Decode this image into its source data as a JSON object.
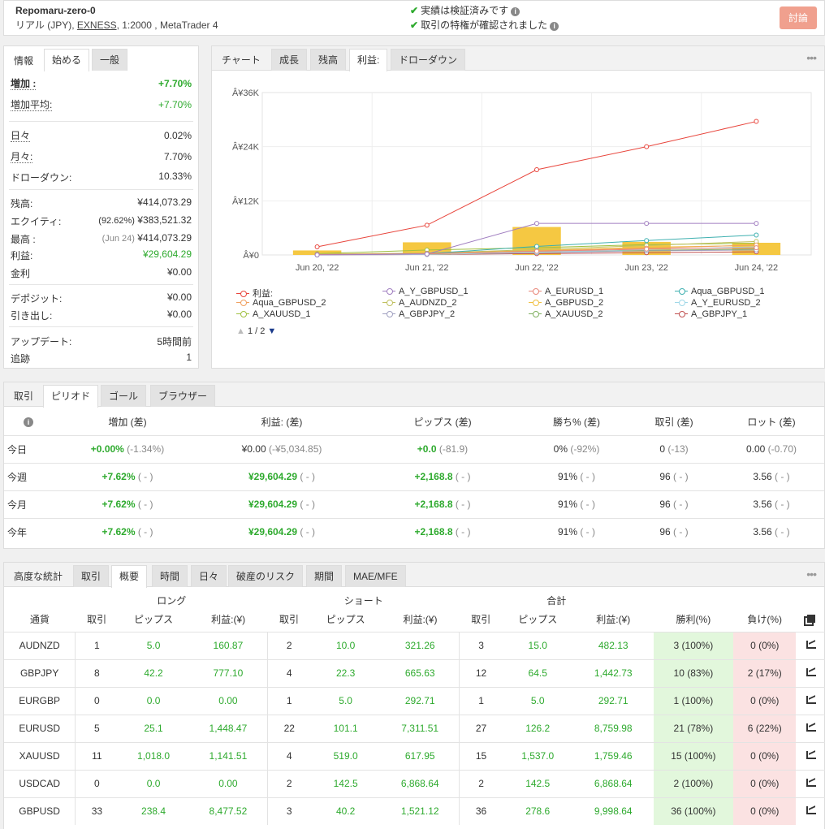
{
  "header": {
    "account_name": "Repomaru-zero-0",
    "account_sub_prefix": "リアル (JPY), ",
    "broker": "EXNESS",
    "account_sub_suffix": ", 1:2000 , MetaTrader 4",
    "verified_track": "実績は検証済みです",
    "verified_privilege": "取引の特権が確認されました",
    "discuss_label": "討論"
  },
  "info_panel": {
    "tabs": [
      "情報",
      "始める",
      "一般"
    ],
    "gain_label": "増加 :",
    "gain_value": "+7.70%",
    "avg_gain_label": "増加平均:",
    "avg_gain_value": "+7.70%",
    "daily_label": "日々",
    "daily_value": "0.02%",
    "monthly_label": "月々:",
    "monthly_value": "7.70%",
    "drawdown_label": "ドローダウン:",
    "drawdown_value": "10.33%",
    "balance_label": "残高:",
    "balance_value": "¥414,073.29",
    "equity_label": "エクイティ:",
    "equity_pct": "(92.62%)",
    "equity_value": "¥383,521.32",
    "highest_label": "最高 :",
    "highest_date": "(Jun 24)",
    "highest_value": "¥414,073.29",
    "profit_label": "利益:",
    "profit_value": "¥29,604.29",
    "interest_label": "金利",
    "interest_value": "¥0.00",
    "deposits_label": "デポジット:",
    "deposits_value": "¥0.00",
    "withdrawals_label": "引き出し:",
    "withdrawals_value": "¥0.00",
    "updated_label": "アップデート:",
    "updated_value": "5時間前",
    "tracking_label": "追跡",
    "tracking_value": "1"
  },
  "chart_panel": {
    "tabs": [
      "チャート",
      "成長",
      "残高",
      "利益:",
      "ドローダウン"
    ],
    "pager": "1 / 2",
    "legend": [
      {
        "label": "利益:",
        "color": "#e8453c"
      },
      {
        "label": "A_Y_GBPUSD_1",
        "color": "#a07ec0"
      },
      {
        "label": "A_EURUSD_1",
        "color": "#e8877a"
      },
      {
        "label": "Aqua_GBPUSD_1",
        "color": "#3fb0b0"
      },
      {
        "label": "Aqua_GBPUSD_2",
        "color": "#f0a060"
      },
      {
        "label": "A_AUDNZD_2",
        "color": "#c0c060"
      },
      {
        "label": "A_GBPUSD_2",
        "color": "#f0c040"
      },
      {
        "label": "A_Y_EURUSD_2",
        "color": "#a0d8e8"
      },
      {
        "label": "A_XAUUSD_1",
        "color": "#a0c040"
      },
      {
        "label": "A_GBPJPY_2",
        "color": "#a0a0c0"
      },
      {
        "label": "A_XAUUSD_2",
        "color": "#80b060"
      },
      {
        "label": "A_GBPJPY_1",
        "color": "#c05050"
      }
    ]
  },
  "chart_data": {
    "type": "line",
    "x": [
      "Jun 20, '22",
      "Jun 21, '22",
      "Jun 22, '22",
      "Jun 23, '22",
      "Jun 24, '22"
    ],
    "y_ticks": [
      "Â¥0",
      "Â¥12K",
      "Â¥24K",
      "Â¥36K"
    ],
    "ylim": [
      0,
      36000
    ],
    "bars": [
      1000,
      2800,
      6200,
      2900,
      2700
    ],
    "bar_color": "#f5c842",
    "series": [
      {
        "name": "利益:",
        "values": [
          1800,
          6600,
          18900,
          24000,
          29600
        ]
      },
      {
        "name": "A_Y_GBPUSD_1",
        "values": [
          0,
          200,
          7000,
          7000,
          7000
        ]
      },
      {
        "name": "A_EURUSD_1",
        "values": [
          100,
          300,
          800,
          1300,
          1600
        ]
      },
      {
        "name": "Aqua_GBPUSD_1",
        "values": [
          0,
          300,
          1900,
          3200,
          4400
        ]
      },
      {
        "name": "Aqua_GBPUSD_2",
        "values": [
          0,
          200,
          900,
          1500,
          2200
        ]
      },
      {
        "name": "A_AUDNZD_2",
        "values": [
          200,
          400,
          1200,
          2100,
          3000
        ]
      },
      {
        "name": "A_GBPUSD_2",
        "values": [
          100,
          300,
          1000,
          1700,
          2100
        ]
      },
      {
        "name": "A_Y_EURUSD_2",
        "values": [
          0,
          100,
          600,
          1200,
          1800
        ]
      },
      {
        "name": "A_XAUUSD_1",
        "values": [
          300,
          1100,
          1600,
          2300,
          2600
        ]
      },
      {
        "name": "A_GBPJPY_2",
        "values": [
          0,
          200,
          500,
          900,
          1100
        ]
      },
      {
        "name": "A_XAUUSD_2",
        "values": [
          100,
          300,
          600,
          1000,
          1300
        ]
      },
      {
        "name": "A_GBPJPY_1",
        "values": [
          0,
          100,
          300,
          500,
          700
        ]
      }
    ]
  },
  "period_panel": {
    "tabs": [
      "取引",
      "ピリオド",
      "ゴール",
      "ブラウザー"
    ],
    "headers": [
      "増加 (差)",
      "利益: (差)",
      "ピップス (差)",
      "勝ち% (差)",
      "取引 (差)",
      "ロット (差)"
    ],
    "rows": [
      {
        "label": "今日",
        "cells": [
          [
            "+0.00%",
            " (-1.34%)"
          ],
          [
            "¥0.00",
            " (-¥5,034.85)"
          ],
          [
            "+0.0",
            " (-81.9)"
          ],
          [
            "0%",
            " (-92%)"
          ],
          [
            "0",
            " (-13)"
          ],
          [
            "0.00",
            " (-0.70)"
          ]
        ]
      },
      {
        "label": "今週",
        "cells": [
          [
            "+7.62%",
            " ( - )"
          ],
          [
            "¥29,604.29",
            " ( - )"
          ],
          [
            "+2,168.8",
            " ( - )"
          ],
          [
            "91%",
            " ( - )"
          ],
          [
            "96",
            " ( - )"
          ],
          [
            "3.56",
            " ( - )"
          ]
        ]
      },
      {
        "label": "今月",
        "cells": [
          [
            "+7.62%",
            " ( - )"
          ],
          [
            "¥29,604.29",
            " ( - )"
          ],
          [
            "+2,168.8",
            " ( - )"
          ],
          [
            "91%",
            " ( - )"
          ],
          [
            "96",
            " ( - )"
          ],
          [
            "3.56",
            " ( - )"
          ]
        ]
      },
      {
        "label": "今年",
        "cells": [
          [
            "+7.62%",
            " ( - )"
          ],
          [
            "¥29,604.29",
            " ( - )"
          ],
          [
            "+2,168.8",
            " ( - )"
          ],
          [
            "91%",
            " ( - )"
          ],
          [
            "96",
            " ( - )"
          ],
          [
            "3.56",
            " ( - )"
          ]
        ]
      }
    ]
  },
  "stats_panel": {
    "tabs": [
      "高度な統計",
      "取引",
      "概要",
      "時間",
      "日々",
      "破産のリスク",
      "期間",
      "MAE/MFE"
    ],
    "group_long": "ロング",
    "group_short": "ショート",
    "group_total": "合計",
    "headers": [
      "通貨",
      "取引",
      "ピップス",
      "利益:(¥)",
      "取引",
      "ピップス",
      "利益:(¥)",
      "取引",
      "ピップス",
      "利益:(¥)",
      "勝利(%)",
      "負け(%)"
    ],
    "rows": [
      [
        "AUDNZD",
        "1",
        "5.0",
        "160.87",
        "2",
        "10.0",
        "321.26",
        "3",
        "15.0",
        "482.13",
        "3 (100%)",
        "0 (0%)"
      ],
      [
        "GBPJPY",
        "8",
        "42.2",
        "777.10",
        "4",
        "22.3",
        "665.63",
        "12",
        "64.5",
        "1,442.73",
        "10 (83%)",
        "2 (17%)"
      ],
      [
        "EURGBP",
        "0",
        "0.0",
        "0.00",
        "1",
        "5.0",
        "292.71",
        "1",
        "5.0",
        "292.71",
        "1 (100%)",
        "0 (0%)"
      ],
      [
        "EURUSD",
        "5",
        "25.1",
        "1,448.47",
        "22",
        "101.1",
        "7,311.51",
        "27",
        "126.2",
        "8,759.98",
        "21 (78%)",
        "6 (22%)"
      ],
      [
        "XAUUSD",
        "11",
        "1,018.0",
        "1,141.51",
        "4",
        "519.0",
        "617.95",
        "15",
        "1,537.0",
        "1,759.46",
        "15 (100%)",
        "0 (0%)"
      ],
      [
        "USDCAD",
        "0",
        "0.0",
        "0.00",
        "2",
        "142.5",
        "6,868.64",
        "2",
        "142.5",
        "6,868.64",
        "2 (100%)",
        "0 (0%)"
      ],
      [
        "GBPUSD",
        "33",
        "238.4",
        "8,477.52",
        "3",
        "40.2",
        "1,521.12",
        "36",
        "278.6",
        "9,998.64",
        "36 (100%)",
        "0 (0%)"
      ]
    ]
  }
}
